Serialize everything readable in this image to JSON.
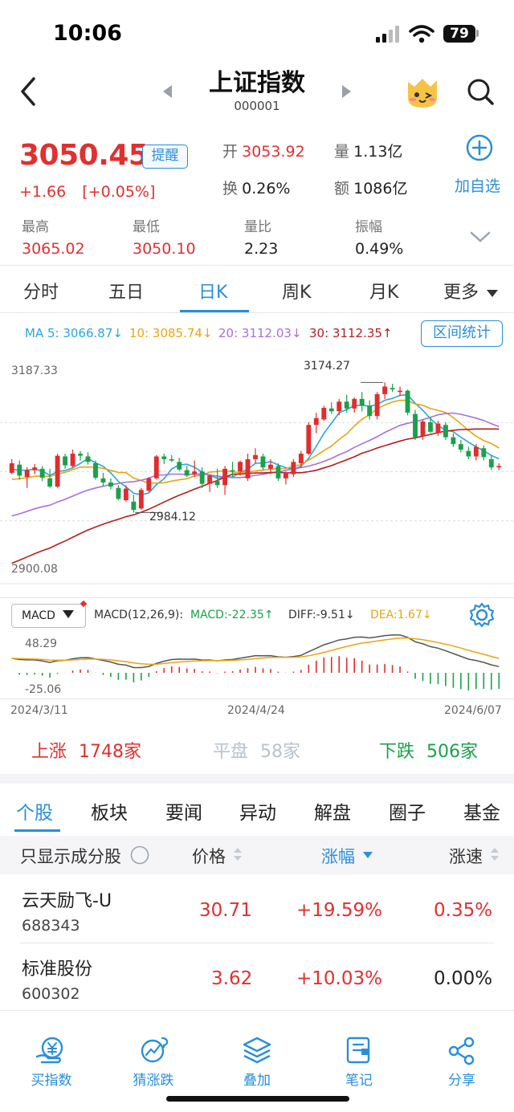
{
  "status_bar": {
    "time": "10:06",
    "battery": "79"
  },
  "header": {
    "title": "上证指数",
    "code": "000001"
  },
  "quote": {
    "price": "3050.45",
    "remind_label": "提醒",
    "change": "+1.66",
    "change_pct": "[+0.05%]",
    "open_label": "开",
    "open": "3053.92",
    "volume_label": "量",
    "volume": "1.13亿",
    "turnover_label": "换",
    "turnover": "0.26%",
    "amount_label": "额",
    "amount": "1086亿",
    "add_label": "加自选",
    "stats": [
      {
        "label": "最高",
        "value": "3065.02",
        "color": "#e03030"
      },
      {
        "label": "最低",
        "value": "3050.10",
        "color": "#e03030"
      },
      {
        "label": "量比",
        "value": "2.23",
        "color": "#222222"
      },
      {
        "label": "振幅",
        "value": "0.49%",
        "color": "#222222"
      }
    ]
  },
  "period_tabs": [
    "分时",
    "五日",
    "日K",
    "周K",
    "月K",
    "更多"
  ],
  "active_tab": "日K",
  "ma": {
    "ma5": "MA 5: 3066.87↓",
    "ma10": "10: 3085.74↓",
    "ma20": "20: 3112.03↓",
    "ma30": "30: 3112.35↑",
    "range_button": "区间统计"
  },
  "kline_labels": {
    "y_top": "3187.33",
    "y_bottom": "2900.08",
    "high_marker": "3174.27",
    "low_marker": "2984.12"
  },
  "macd": {
    "selector": "MACD",
    "params": "MACD(12,26,9):",
    "macd": "MACD:-22.35↑",
    "diff": "DIFF:-9.51↓",
    "dea": "DEA:1.67↓",
    "y_top": "48.29",
    "y_bottom": "-25.06"
  },
  "dates": {
    "start": "2024/3/11",
    "mid": "2024/4/24",
    "end": "2024/6/07"
  },
  "market_breadth": {
    "up_label": "上涨",
    "up_count": "1748家",
    "flat_label": "平盘",
    "flat_count": "58家",
    "down_label": "下跌",
    "down_count": "506家"
  },
  "categories": [
    "个股",
    "板块",
    "要闻",
    "异动",
    "解盘",
    "圈子",
    "基金"
  ],
  "table": {
    "filter_label": "只显示成分股",
    "col_price": "价格",
    "col_change": "涨幅",
    "col_speed": "涨速",
    "rows": [
      {
        "name": "云天励飞-U",
        "code": "688343",
        "price": "30.71",
        "change": "+19.59%",
        "speed": "0.35%"
      },
      {
        "name": "标准股份",
        "code": "600302",
        "price": "3.62",
        "change": "+10.03%",
        "speed": "0.00%"
      }
    ]
  },
  "bottom_nav": [
    "买指数",
    "猜涨跌",
    "叠加",
    "笔记",
    "分享"
  ],
  "chart_data": {
    "type": "candlestick",
    "x_start": "2024/3/11",
    "x_end": "2024/6/07",
    "ylim": [
      2900.08,
      3187.33
    ],
    "max_marked": 3174.27,
    "min_marked": 2984.12,
    "ohlc": [
      [
        3042,
        3062,
        3040,
        3056
      ],
      [
        3054,
        3060,
        3032,
        3038
      ],
      [
        3036,
        3050,
        3020,
        3046
      ],
      [
        3046,
        3055,
        3040,
        3050
      ],
      [
        3048,
        3052,
        3030,
        3035
      ],
      [
        3034,
        3048,
        3020,
        3022
      ],
      [
        3022,
        3070,
        3020,
        3067
      ],
      [
        3066,
        3070,
        3048,
        3053
      ],
      [
        3052,
        3076,
        3050,
        3070
      ],
      [
        3070,
        3074,
        3060,
        3067
      ],
      [
        3066,
        3072,
        3054,
        3058
      ],
      [
        3056,
        3060,
        3032,
        3035
      ],
      [
        3034,
        3042,
        3022,
        3028
      ],
      [
        3028,
        3034,
        3018,
        3022
      ],
      [
        3020,
        3024,
        3002,
        3004
      ],
      [
        3002,
        3024,
        3000,
        3019
      ],
      [
        3000,
        3010,
        2984,
        2988
      ],
      [
        2990,
        3020,
        2988,
        3017
      ],
      [
        3016,
        3036,
        3014,
        3034
      ],
      [
        3034,
        3068,
        3032,
        3066
      ],
      [
        3066,
        3070,
        3055,
        3062
      ],
      [
        3062,
        3068,
        3058,
        3060
      ],
      [
        3058,
        3064,
        3045,
        3047
      ],
      [
        3046,
        3052,
        3036,
        3038
      ],
      [
        3040,
        3060,
        3036,
        3044
      ],
      [
        3044,
        3050,
        3020,
        3026
      ],
      [
        3026,
        3040,
        3014,
        3038
      ],
      [
        3030,
        3048,
        3020,
        3024
      ],
      [
        3024,
        3052,
        3010,
        3048
      ],
      [
        3046,
        3058,
        3036,
        3044
      ],
      [
        3044,
        3060,
        3038,
        3058
      ],
      [
        3034,
        3070,
        3030,
        3062
      ],
      [
        3062,
        3078,
        3056,
        3068
      ],
      [
        3066,
        3070,
        3046,
        3050
      ],
      [
        3048,
        3062,
        3040,
        3054
      ],
      [
        3052,
        3056,
        3030,
        3034
      ],
      [
        3034,
        3044,
        3025,
        3042
      ],
      [
        3040,
        3062,
        3036,
        3058
      ],
      [
        3056,
        3074,
        3050,
        3070
      ],
      [
        3070,
        3116,
        3068,
        3112
      ],
      [
        3112,
        3130,
        3100,
        3122
      ],
      [
        3120,
        3140,
        3118,
        3137
      ],
      [
        3136,
        3145,
        3128,
        3132
      ],
      [
        3132,
        3150,
        3126,
        3146
      ],
      [
        3146,
        3156,
        3130,
        3136
      ],
      [
        3136,
        3152,
        3130,
        3150
      ],
      [
        3150,
        3160,
        3132,
        3140
      ],
      [
        3140,
        3148,
        3120,
        3125
      ],
      [
        3125,
        3160,
        3120,
        3157
      ],
      [
        3157,
        3174,
        3150,
        3168
      ],
      [
        3166,
        3172,
        3160,
        3164
      ],
      [
        3160,
        3168,
        3154,
        3162
      ],
      [
        3162,
        3164,
        3126,
        3130
      ],
      [
        3128,
        3134,
        3090,
        3094
      ],
      [
        3096,
        3120,
        3090,
        3117
      ],
      [
        3116,
        3124,
        3100,
        3102
      ],
      [
        3100,
        3118,
        3096,
        3114
      ],
      [
        3112,
        3116,
        3090,
        3094
      ],
      [
        3094,
        3100,
        3080,
        3084
      ],
      [
        3084,
        3090,
        3072,
        3076
      ],
      [
        3074,
        3080,
        3062,
        3066
      ],
      [
        3066,
        3084,
        3060,
        3080
      ],
      [
        3078,
        3082,
        3060,
        3065
      ],
      [
        3062,
        3068,
        3046,
        3050
      ],
      [
        3050,
        3056,
        3046,
        3052
      ]
    ]
  }
}
